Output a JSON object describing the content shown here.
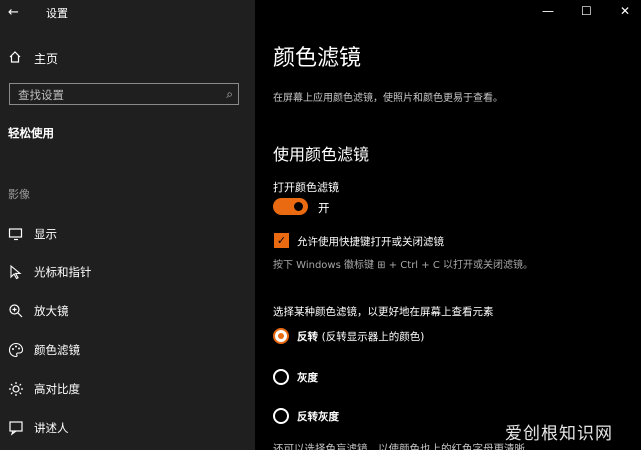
{
  "app": {
    "title": "设置"
  },
  "sidebar": {
    "home": "主页",
    "search_placeholder": "查找设置",
    "section": "轻松使用",
    "group": "影像",
    "items": [
      {
        "label": "显示",
        "icon": "monitor-icon"
      },
      {
        "label": "光标和指针",
        "icon": "cursor-icon"
      },
      {
        "label": "放大镜",
        "icon": "magnifier-icon"
      },
      {
        "label": "颜色滤镜",
        "icon": "palette-icon"
      },
      {
        "label": "高对比度",
        "icon": "brightness-icon"
      },
      {
        "label": "讲述人",
        "icon": "narrator-icon"
      }
    ]
  },
  "window": {
    "minimize": "—",
    "maximize": "☐",
    "close": "✕"
  },
  "main": {
    "title": "颜色滤镜",
    "description": "在屏幕上应用颜色滤镜，使照片和颜色更易于查看。",
    "section_title": "使用颜色滤镜",
    "toggle_label": "打开颜色滤镜",
    "toggle_state": "开",
    "toggle_on": true,
    "shortcut_checkbox_label": "允许使用快捷键打开或关闭滤镜",
    "shortcut_checked": true,
    "shortcut_hint": "按下 Windows 徽标键 ⊞ + Ctrl + C 以打开或关闭滤镜。",
    "select_label": "选择某种颜色滤镜，以更好地在屏幕上查看元素",
    "filters": [
      {
        "label": "反转",
        "note": "(反转显示器上的颜色)",
        "selected": true
      },
      {
        "label": "灰度",
        "note": "",
        "selected": false
      },
      {
        "label": "反转灰度",
        "note": "",
        "selected": false
      }
    ],
    "cut_off_text": "还可以选择色盲滤镜，以使颜色也上的红色字母更清晰"
  },
  "watermark": "爱创根知识网",
  "colors": {
    "accent": "#e96a10",
    "sidebar_bg": "#1f1f1f",
    "main_bg": "#000000"
  }
}
